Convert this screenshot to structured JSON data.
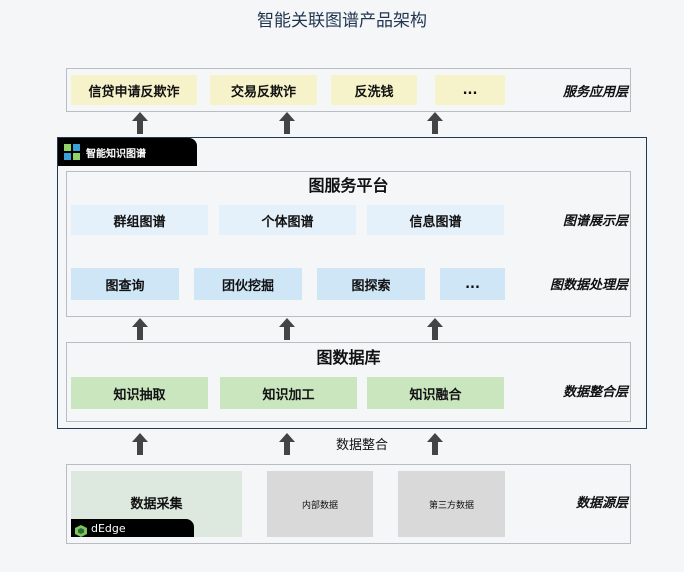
{
  "title": "智能关联图谱产品架构",
  "layers": {
    "application": {
      "label": "服务应用层",
      "items": [
        "信贷申请反欺诈",
        "交易反欺诈",
        "反洗钱",
        "..."
      ]
    },
    "platform": {
      "badge": "智能知识图谱",
      "graph_service": {
        "title": "图服务平台",
        "display": {
          "label": "图谱展示层",
          "items": [
            "群组图谱",
            "个体图谱",
            "信息图谱"
          ]
        },
        "processing": {
          "label": "图数据处理层",
          "items": [
            "图查询",
            "团伙挖掘",
            "图探索",
            "..."
          ]
        }
      },
      "graph_db": {
        "title": "图数据库",
        "label": "数据整合层",
        "items": [
          "知识抽取",
          "知识加工",
          "知识融合"
        ]
      }
    },
    "integration_label": "数据整合",
    "source": {
      "label": "数据源层",
      "collection": "数据采集",
      "collection_badge": "dEdge",
      "items": [
        "内部数据",
        "第三方数据"
      ]
    }
  },
  "colors": {
    "yellow": "#f6f2c9",
    "blue_light": "#e4f0fa",
    "blue": "#cfe6f7",
    "green": "#c9e6bf",
    "gray": "#d9d9d9",
    "source_green": "#dde9de",
    "frame": "#1e3a56"
  }
}
